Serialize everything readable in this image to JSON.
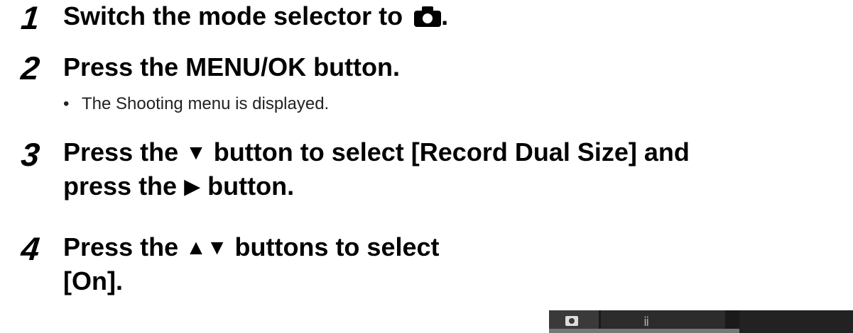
{
  "steps": [
    {
      "number": "1",
      "title_pre": "Switch the mode selector to ",
      "title_icon": "camera-icon",
      "title_post": "."
    },
    {
      "number": "2",
      "title": "Press the MENU/OK button.",
      "note": "The Shooting menu is displayed."
    },
    {
      "number": "3",
      "line1_a": "Press the ",
      "line1_sym": "▼",
      "line1_b": " button to select [Record Dual Size] and",
      "line2_a": "press the ",
      "line2_sym": "▶",
      "line2_b": " button."
    },
    {
      "number": "4",
      "line1_a": "Press the ",
      "line1_sym": "▲▼",
      "line1_b": " buttons to select",
      "line2": "[On]."
    }
  ],
  "bullet": "•",
  "lcd": {
    "camera_tab_icon": "camera-icon",
    "setup_tab_icon": "wrench-icon",
    "setup_glyph": "ⅱ"
  }
}
